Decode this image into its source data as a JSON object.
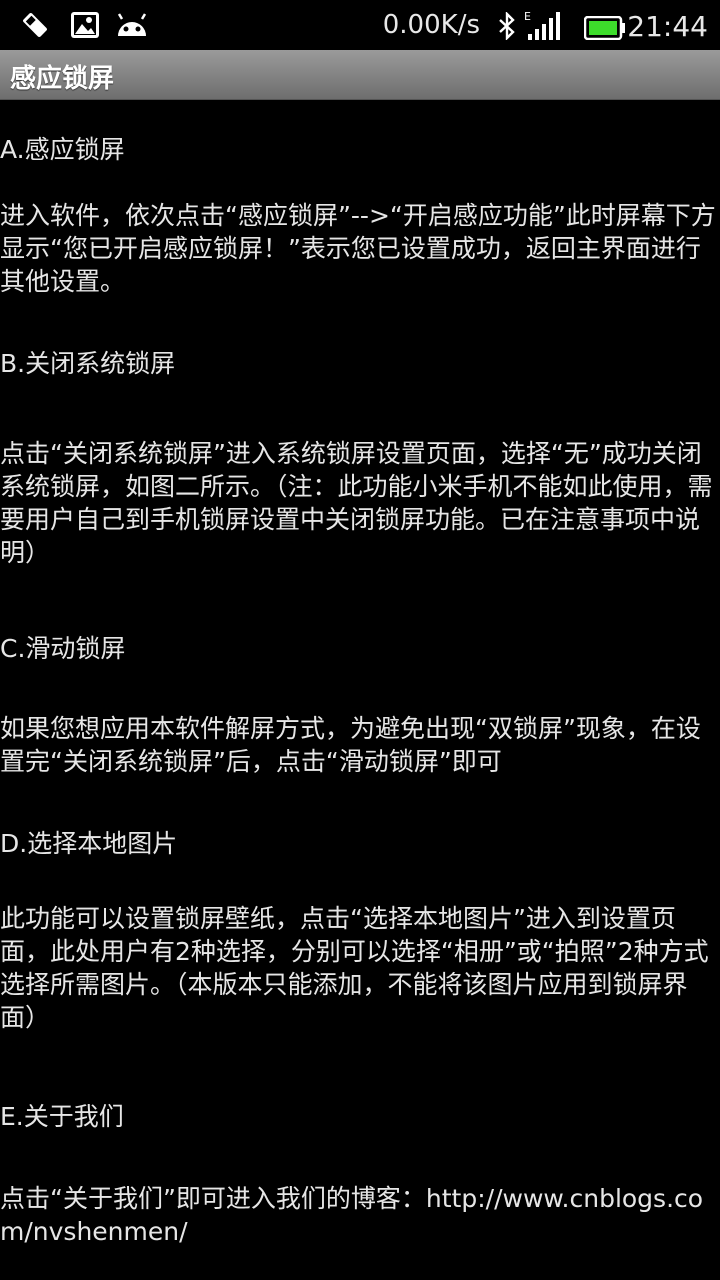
{
  "status_bar": {
    "net_speed": "0.00K/s",
    "time": "21:44",
    "network_type": "E",
    "battery_color": "#3ddc2b",
    "icons": [
      "usb-debug-icon",
      "image-icon",
      "android-icon",
      "bluetooth-icon",
      "signal-icon",
      "battery-icon"
    ]
  },
  "title_bar": {
    "title": "感应锁屏"
  },
  "sections": [
    {
      "heading": "A.感应锁屏",
      "body": "进入软件，依次点击“感应锁屏”-->“开启感应功能”此时屏幕下方显示“您已开启感应锁屏！”表示您已设置成功，返回主界面进行其他设置。"
    },
    {
      "heading": "B.关闭系统锁屏",
      "body": "点击“关闭系统锁屏”进入系统锁屏设置页面，选择“无”成功关闭系统锁屏，如图二所示。（注：此功能小米手机不能如此使用，需要用户自己到手机锁屏设置中关闭锁屏功能。已在注意事项中说明）"
    },
    {
      "heading": "C.滑动锁屏",
      "body": "如果您想应用本软件解屏方式，为避免出现“双锁屏”现象，在设置完“关闭系统锁屏”后，点击“滑动锁屏”即可"
    },
    {
      "heading": "D.选择本地图片",
      "body": "此功能可以设置锁屏壁纸，点击“选择本地图片”进入到设置页面，此处用户有2种选择，分别可以选择“相册”或“拍照”2种方式选择所需图片。（本版本只能添加，不能将该图片应用到锁屏界面）"
    },
    {
      "heading": "E.关于我们",
      "body": "点击“关于我们”即可进入我们的博客：http://www.cnblogs.com/nvshenmen/"
    }
  ]
}
